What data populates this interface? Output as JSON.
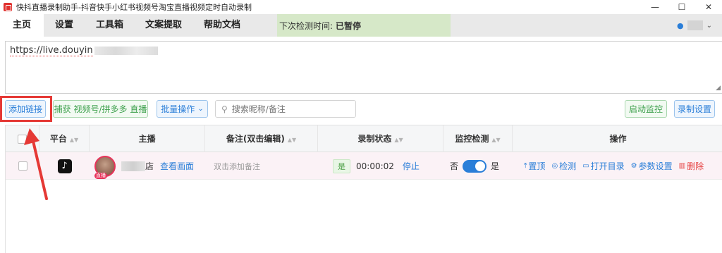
{
  "window": {
    "title": "快抖直播录制助手-抖音快手小红书视频号淘宝直播视频定时自动录制",
    "controls": {
      "minimize": "—",
      "maximize": "☐",
      "close": "✕"
    }
  },
  "tabs": [
    {
      "label": "主页",
      "active": true
    },
    {
      "label": "设置"
    },
    {
      "label": "工具箱"
    },
    {
      "label": "文案提取"
    },
    {
      "label": "帮助文档"
    }
  ],
  "status": {
    "label": "下次检测时间:",
    "value": "已暂停"
  },
  "user": {
    "chevron": "⌄"
  },
  "url_input": {
    "value": "https://live.douyin"
  },
  "toolbar": {
    "add_link": "添加链接",
    "capture": "捕获 视频号/拼多多 直播",
    "batch": "批量操作",
    "batch_chevron": "⌄",
    "search_placeholder": "搜索昵称/备注",
    "start_monitor": "启动监控",
    "record_settings": "录制设置"
  },
  "table": {
    "headers": {
      "platform": "平台",
      "anchor": "主播",
      "note": "备注(双击编辑)",
      "record_status": "录制状态",
      "monitor": "监控检测",
      "actions": "操作"
    },
    "rows": [
      {
        "platform_icon": "tiktok-icon",
        "live_tag": "直播",
        "anchor_suffix": "店",
        "view": "查看画面",
        "note_placeholder": "双击添加备注",
        "status_badge": "是",
        "duration": "00:00:02",
        "stop": "停止",
        "monitor_off": "否",
        "monitor_on": "是",
        "monitor_enabled": true,
        "actions": {
          "top": "置顶",
          "check": "检测",
          "open_dir": "打开目录",
          "params": "参数设置",
          "delete": "删除"
        }
      }
    ]
  },
  "colors": {
    "accent": "#2a7ed8",
    "green": "#3da04c",
    "danger": "#e64545",
    "annotation": "#e53935"
  }
}
